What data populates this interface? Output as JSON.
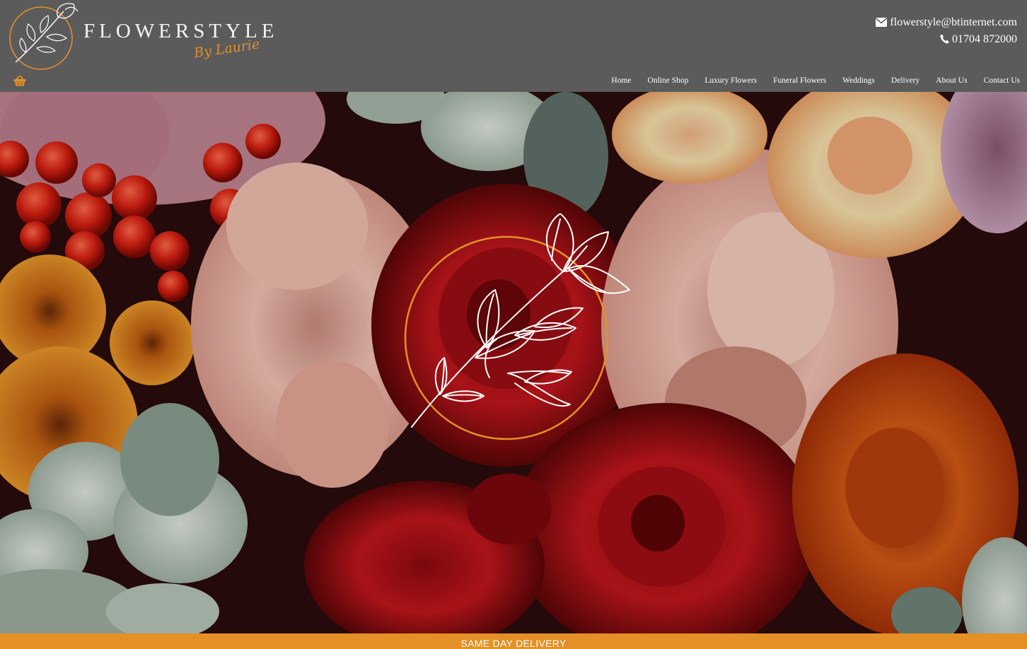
{
  "brand": {
    "name": "FLOWERSTYLE",
    "tagline": "By Laurie",
    "accent_color": "#e59026",
    "header_color": "#5b5b5b"
  },
  "contact": {
    "email": "flowerstyle@btinternet.com",
    "email_icon": "envelope-icon",
    "phone": "01704 872000",
    "phone_icon": "phone-icon"
  },
  "cart": {
    "icon": "shopping-basket-icon"
  },
  "nav": {
    "items": [
      {
        "label": "Home"
      },
      {
        "label": "Online Shop"
      },
      {
        "label": "Luxury Flowers"
      },
      {
        "label": "Funeral Flowers"
      },
      {
        "label": "Weddings"
      },
      {
        "label": "Delivery"
      },
      {
        "label": "About Us"
      },
      {
        "label": "Contact Us"
      }
    ]
  },
  "hero": {
    "image": "flower-bouquet-photo",
    "emblem_icon": "flower-line-art-icon"
  },
  "banner": {
    "text": "SAME DAY DELIVERY"
  }
}
